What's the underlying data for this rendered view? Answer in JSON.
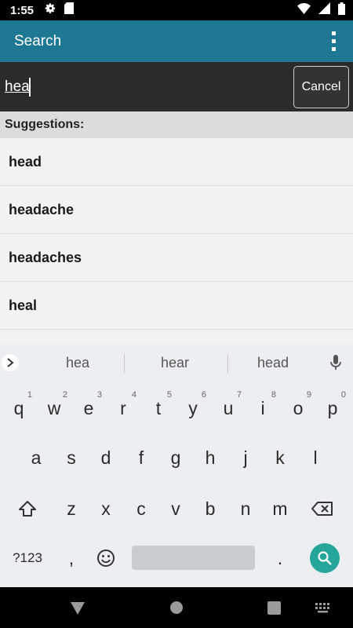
{
  "status_bar": {
    "time": "1:55",
    "icons": [
      "settings-icon",
      "sd-card-icon",
      "wifi-icon",
      "signal-icon",
      "battery-icon"
    ]
  },
  "app_bar": {
    "title": "Search",
    "menu_icon": "overflow-menu-icon"
  },
  "search": {
    "value": "hea",
    "cancel_label": "Cancel"
  },
  "suggestions": {
    "header": "Suggestions:",
    "items": [
      "head",
      "headache",
      "headaches",
      "heal"
    ]
  },
  "keyboard": {
    "suggestions": [
      "hea",
      "hear",
      "head"
    ],
    "row1": [
      {
        "k": "q",
        "h": "1"
      },
      {
        "k": "w",
        "h": "2"
      },
      {
        "k": "e",
        "h": "3"
      },
      {
        "k": "r",
        "h": "4"
      },
      {
        "k": "t",
        "h": "5"
      },
      {
        "k": "y",
        "h": "6"
      },
      {
        "k": "u",
        "h": "7"
      },
      {
        "k": "i",
        "h": "8"
      },
      {
        "k": "o",
        "h": "9"
      },
      {
        "k": "p",
        "h": "0"
      }
    ],
    "row2": [
      "a",
      "s",
      "d",
      "f",
      "g",
      "h",
      "j",
      "k",
      "l"
    ],
    "row3": [
      "z",
      "x",
      "c",
      "v",
      "b",
      "n",
      "m"
    ],
    "symbols_label": "?123",
    "comma": ",",
    "period": "."
  },
  "colors": {
    "app_bar": "#1e7894",
    "search_key": "#26a69a"
  }
}
